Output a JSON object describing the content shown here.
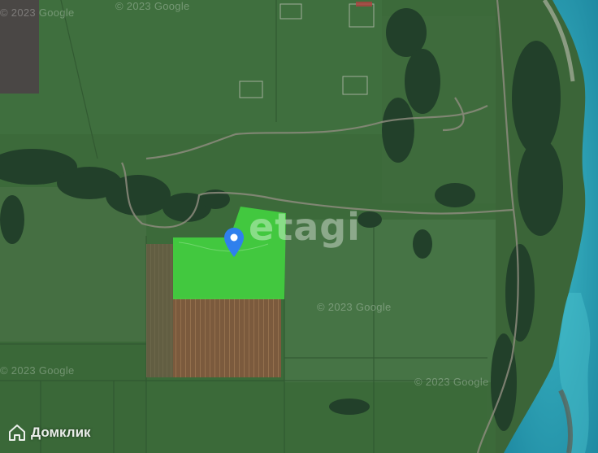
{
  "map": {
    "watermarks": {
      "google_top": "© 2023 Google",
      "google_mid": "© 2023 Google",
      "google_left": "© 2023 Google",
      "google_tl": "© 2023 Google",
      "google_right": "© 2023 Google"
    },
    "overlay_brand": "etagi",
    "marker": {
      "icon": "location-pin-icon",
      "color": "#2f80ed"
    },
    "plot_highlight_color": "#3bd23a",
    "river_color": "#2aa6b8"
  },
  "footer": {
    "brand_name": "Домклик",
    "brand_icon": "home-icon"
  }
}
